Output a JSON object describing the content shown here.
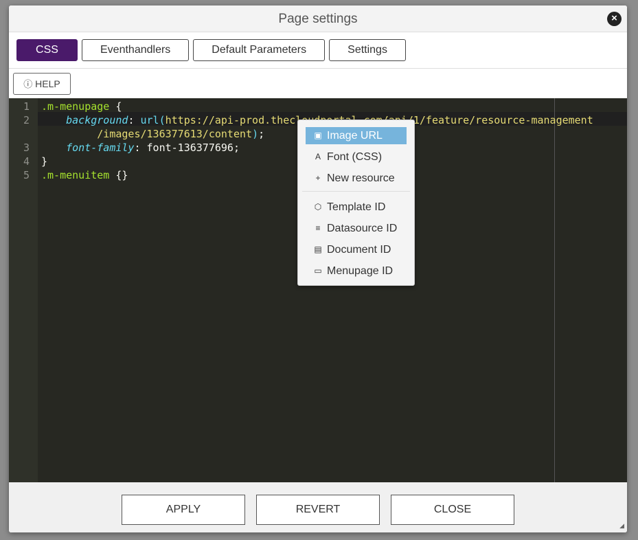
{
  "dialog": {
    "title": "Page settings",
    "close_icon": "close-circle-icon"
  },
  "tabs": [
    {
      "label": "CSS",
      "active": true
    },
    {
      "label": "Eventhandlers"
    },
    {
      "label": "Default Parameters"
    },
    {
      "label": "Settings"
    }
  ],
  "help": {
    "label": "HELP",
    "icon": "question-circle-icon"
  },
  "accent": "#4a1a6a",
  "editor": {
    "lines": [
      {
        "n": "1",
        "sel": ".m-menupage",
        "rest": " {"
      },
      {
        "n": "2",
        "prop": "background",
        "url1": "https://api-prod.thecloudportal.com/api/1/feature/resource-management",
        "url2": "/images/136377613/content"
      },
      {
        "n": "3",
        "prop": "font-family",
        "value": ": font-136377696;"
      },
      {
        "n": "4",
        "text": "}"
      },
      {
        "n": "5",
        "sel": ".m-menuitem",
        "rest": " {}"
      }
    ]
  },
  "context_menu": {
    "items": [
      {
        "label": "Image URL",
        "icon": "image-icon",
        "highlighted": true
      },
      {
        "label": "Font (CSS)",
        "icon": "font-icon"
      },
      {
        "label": "New resource",
        "icon": "plus-icon"
      },
      {
        "label": "Template ID",
        "icon": "cube-icon"
      },
      {
        "label": "Datasource ID",
        "icon": "database-icon"
      },
      {
        "label": "Document ID",
        "icon": "document-icon"
      },
      {
        "label": "Menupage ID",
        "icon": "tv-icon"
      }
    ]
  },
  "footer": {
    "apply": "APPLY",
    "revert": "REVERT",
    "close": "CLOSE"
  }
}
